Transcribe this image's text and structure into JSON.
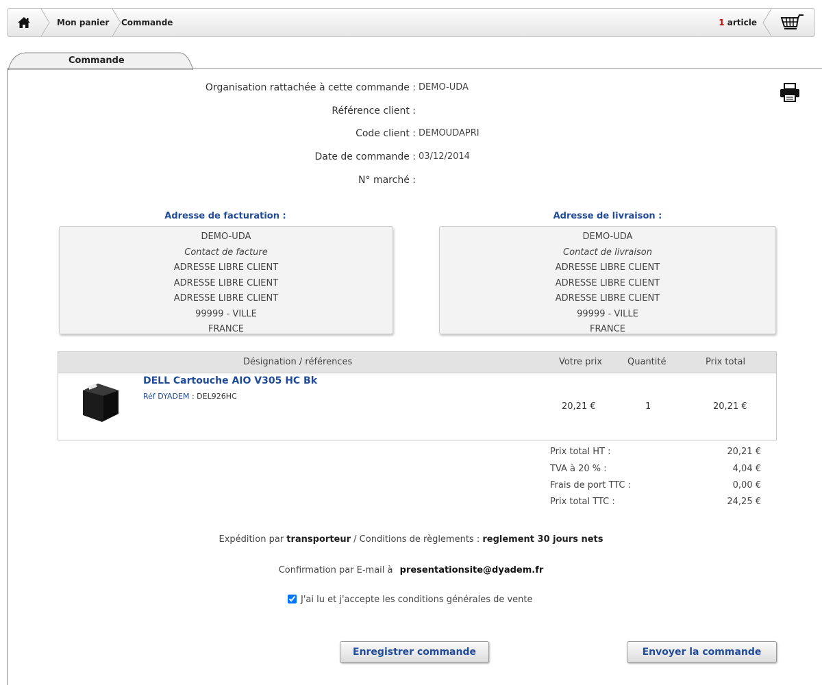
{
  "breadcrumb": {
    "item1": "Mon panier",
    "item2": "Commande"
  },
  "cart": {
    "count": "1",
    "label": "article"
  },
  "tab": {
    "label": "Commande"
  },
  "info": {
    "org_label": "Organisation rattachée à cette commande :",
    "org_value": "DEMO-UDA",
    "ref_label": "Référence client :",
    "ref_value": "",
    "code_label": "Code client :",
    "code_value": "DEMOUDAPRI",
    "date_label": "Date de commande :",
    "date_value": "03/12/2014",
    "marche_label": "N° marché :",
    "marche_value": ""
  },
  "billing": {
    "title": "Adresse de facturation :",
    "lines": [
      "DEMO-UDA",
      "Contact de facture",
      "ADRESSE LIBRE CLIENT",
      "ADRESSE LIBRE CLIENT",
      "ADRESSE LIBRE CLIENT",
      "99999 - VILLE",
      "FRANCE"
    ]
  },
  "shipping": {
    "title": "Adresse de livraison :",
    "lines": [
      "DEMO-UDA",
      "Contact de livraison",
      "ADRESSE LIBRE CLIENT",
      "ADRESSE LIBRE CLIENT",
      "ADRESSE LIBRE CLIENT",
      "99999 - VILLE",
      "FRANCE"
    ]
  },
  "table": {
    "headers": [
      "Désignation / références",
      "Votre prix",
      "Quantité",
      "Prix total"
    ],
    "product": {
      "name": "DELL Cartouche AIO V305 HC Bk",
      "ref_label": "Réf DYADEM :",
      "ref_value": "DEL926HC",
      "price": "20,21 €",
      "qty": "1",
      "total": "20,21 €"
    }
  },
  "totals": [
    {
      "label": "Prix total HT :",
      "value": "20,21 €"
    },
    {
      "label": "TVA à 20 % :",
      "value": "4,04 €"
    },
    {
      "label": "Frais de port TTC :",
      "value": "0,00 €"
    },
    {
      "label": "Prix total TTC :",
      "value": "24,25 €"
    }
  ],
  "shipping_info": {
    "prefix": "Expédition par",
    "carrier": "transporteur",
    "mid": "/ Conditions de règlements :",
    "terms": "reglement 30 jours nets"
  },
  "confirmation": {
    "prefix": "Confirmation par E-mail à",
    "email": "presentationsite@dyadem.fr"
  },
  "cgv": {
    "label": "J'ai lu et j'accepte les conditions générales de vente",
    "checked": true
  },
  "buttons": {
    "save": "Enregistrer commande",
    "send": "Envoyer la commande"
  }
}
